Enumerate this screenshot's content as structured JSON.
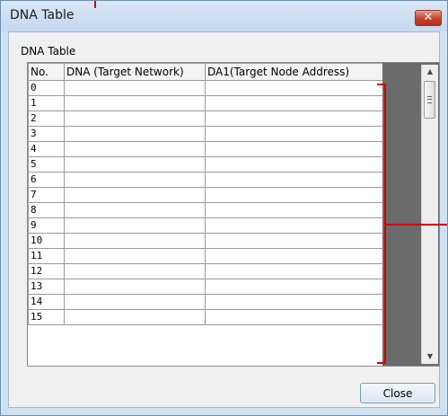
{
  "window": {
    "title": "DNA Table",
    "close_glyph": "✕"
  },
  "group_label": "DNA Table",
  "table": {
    "headers": [
      "No.",
      "DNA (Target Network)",
      "DA1(Target Node Address)"
    ],
    "rows": [
      {
        "no": "0",
        "dna": "",
        "da1": ""
      },
      {
        "no": "1",
        "dna": "",
        "da1": ""
      },
      {
        "no": "2",
        "dna": "",
        "da1": ""
      },
      {
        "no": "3",
        "dna": "",
        "da1": ""
      },
      {
        "no": "4",
        "dna": "",
        "da1": ""
      },
      {
        "no": "5",
        "dna": "",
        "da1": ""
      },
      {
        "no": "6",
        "dna": "",
        "da1": ""
      },
      {
        "no": "7",
        "dna": "",
        "da1": ""
      },
      {
        "no": "8",
        "dna": "",
        "da1": ""
      },
      {
        "no": "9",
        "dna": "",
        "da1": ""
      },
      {
        "no": "10",
        "dna": "",
        "da1": ""
      },
      {
        "no": "11",
        "dna": "",
        "da1": ""
      },
      {
        "no": "12",
        "dna": "",
        "da1": ""
      },
      {
        "no": "13",
        "dna": "",
        "da1": ""
      },
      {
        "no": "14",
        "dna": "",
        "da1": ""
      },
      {
        "no": "15",
        "dna": "",
        "da1": ""
      }
    ]
  },
  "scrollbar": {
    "up_icon": "▲",
    "down_icon": "▼"
  },
  "buttons": {
    "close_label": "Close"
  },
  "colors": {
    "annotation_red": "#d00000",
    "title_bar": "#d9e7f6"
  }
}
